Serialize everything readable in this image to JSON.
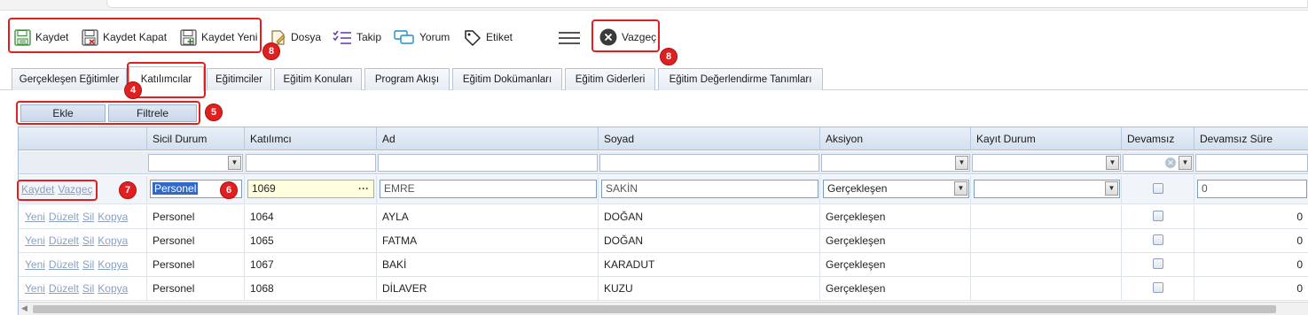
{
  "toolbar": {
    "kaydet": "Kaydet",
    "kaydet_kapat": "Kaydet Kapat",
    "kaydet_yeni": "Kaydet Yeni",
    "dosya": "Dosya",
    "takip": "Takip",
    "yorum": "Yorum",
    "etiket": "Etiket",
    "vazgec": "Vazgeç"
  },
  "tabs": [
    {
      "label": "Gerçekleşen Eğitimler"
    },
    {
      "label": "Katılımcılar"
    },
    {
      "label": "Eğitimciler"
    },
    {
      "label": "Eğitim Konuları"
    },
    {
      "label": "Program Akışı"
    },
    {
      "label": "Eğitim Dokümanları"
    },
    {
      "label": "Eğitim Giderleri"
    },
    {
      "label": "Eğitim Değerlendirme Tanımları"
    }
  ],
  "subbar": {
    "ekle": "Ekle",
    "filtrele": "Filtrele"
  },
  "badges": {
    "b4": "4",
    "b5": "5",
    "b6": "6",
    "b7": "7",
    "b8a": "8",
    "b8b": "8"
  },
  "grid": {
    "columns": [
      "Sicil Durum",
      "Katılımcı",
      "Ad",
      "Soyad",
      "Aksiyon",
      "Kayıt Durum",
      "Devamsız",
      "Devamsız Süre"
    ],
    "edit_row": {
      "kaydet_link": "Kaydet",
      "vazgec_link": "Vazgeç",
      "sicil_durum": "Personel",
      "katilimci": "1069",
      "ad": "EMRE",
      "soyad": "SAKİN",
      "aksiyon": "Gerçekleşen",
      "kayit_durum": "",
      "devamsiz_sure": "0"
    },
    "row_actions": {
      "yeni": "Yeni",
      "duzelt": "Düzelt",
      "sil": "Sil",
      "kopya": "Kopya"
    },
    "rows": [
      {
        "sicil_durum": "Personel",
        "katilimci": "1064",
        "ad": "AYLA",
        "soyad": "DOĞAN",
        "aksiyon": "Gerçekleşen",
        "kayit_durum": "",
        "devamsiz_sure": "0"
      },
      {
        "sicil_durum": "Personel",
        "katilimci": "1065",
        "ad": "FATMA",
        "soyad": "DOĞAN",
        "aksiyon": "Gerçekleşen",
        "kayit_durum": "",
        "devamsiz_sure": "0"
      },
      {
        "sicil_durum": "Personel",
        "katilimci": "1067",
        "ad": "BAKİ",
        "soyad": "KARADUT",
        "aksiyon": "Gerçekleşen",
        "kayit_durum": "",
        "devamsiz_sure": "0"
      },
      {
        "sicil_durum": "Personel",
        "katilimci": "1068",
        "ad": "DİLAVER",
        "soyad": "KUZU",
        "aksiyon": "Gerçekleşen",
        "kayit_durum": "",
        "devamsiz_sure": "0"
      }
    ]
  }
}
